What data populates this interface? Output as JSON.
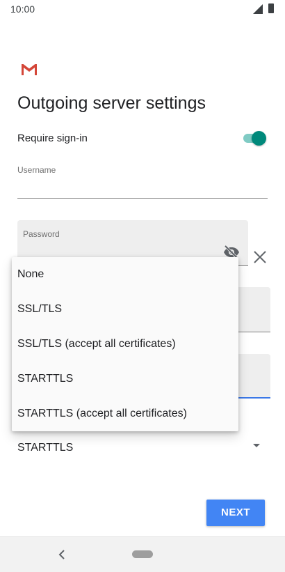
{
  "status_bar": {
    "time": "10:00"
  },
  "title": "Outgoing server settings",
  "require_signin": {
    "label": "Require sign-in",
    "enabled": true
  },
  "username": {
    "label": "Username",
    "value": ""
  },
  "password": {
    "label": "Password",
    "value": ""
  },
  "security_type": {
    "selected": "STARTTLS"
  },
  "dropdown": {
    "options": [
      "None",
      "SSL/TLS",
      "SSL/TLS (accept all certificates)",
      "STARTTLS",
      "STARTTLS (accept all certificates)"
    ]
  },
  "next_button": {
    "label": "NEXT"
  },
  "colors": {
    "accent": "#00897b",
    "button": "#4285f4",
    "focus_underline": "#3b78e7"
  }
}
